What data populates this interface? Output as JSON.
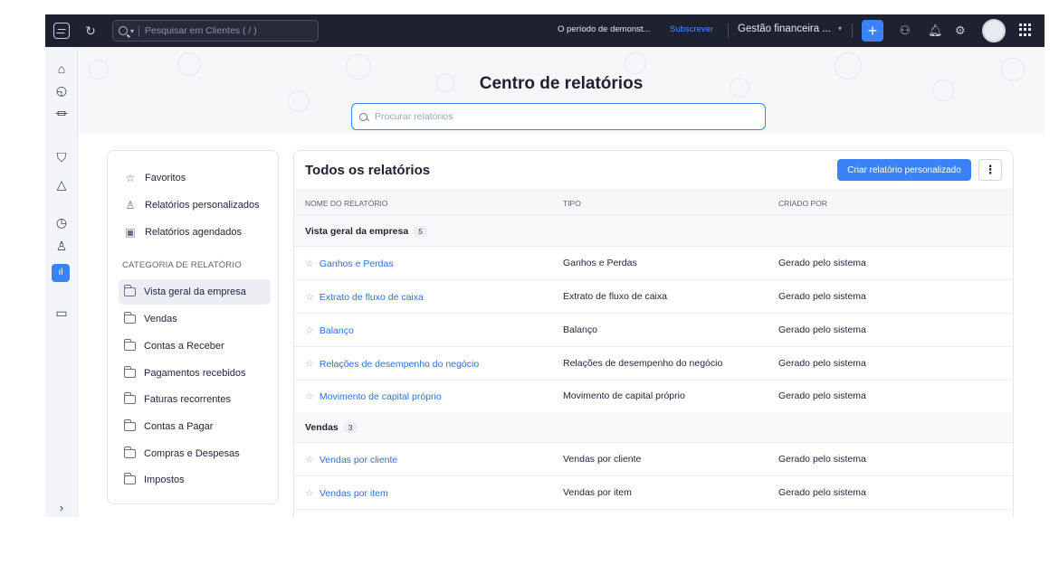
{
  "topbar": {
    "search_placeholder": "Pesquisar em Clientes ( / )",
    "trial_text": "O período de demonst...",
    "subscribe_label": "Subscrever",
    "org_name": "Gestão financeira ...",
    "plus_label": "+"
  },
  "hero": {
    "title": "Centro de relatórios",
    "search_placeholder": "Procurar relatórios"
  },
  "sidebar": {
    "favorites": "Favoritos",
    "custom_reports": "Relatórios personalizados",
    "scheduled_reports": "Relatórios agendados",
    "category_heading": "CATEGORIA DE RELATÓRIO",
    "categories": [
      "Vista geral da empresa",
      "Vendas",
      "Contas a Receber",
      "Pagamentos recebidos",
      "Faturas recorrentes",
      "Contas a Pagar",
      "Compras e Despesas",
      "Impostos"
    ]
  },
  "reports": {
    "title": "Todos os relatórios",
    "create_button": "Criar relatório personalizado",
    "more_button": "⋮",
    "columns": [
      "NOME DO RELATÓRIO",
      "TIPO",
      "CRIADO POR"
    ],
    "groups": [
      {
        "name": "Vista geral da empresa",
        "count": "5",
        "rows": [
          {
            "name": "Ganhos e Perdas",
            "type": "Ganhos e Perdas",
            "created_by": "Gerado pelo sistema"
          },
          {
            "name": "Extrato de fluxo de caixa",
            "type": "Extrato de fluxo de caixa",
            "created_by": "Gerado pelo sistema"
          },
          {
            "name": "Balanço",
            "type": "Balanço",
            "created_by": "Gerado pelo sistema"
          },
          {
            "name": "Relações de desempenho do negócio",
            "type": "Relações de desempenho do negócio",
            "created_by": "Gerado pelo sistema"
          },
          {
            "name": "Movimento de capital próprio",
            "type": "Movimento de capital próprio",
            "created_by": "Gerado pelo sistema"
          }
        ]
      },
      {
        "name": "Vendas",
        "count": "3",
        "rows": [
          {
            "name": "Vendas por cliente",
            "type": "Vendas por cliente",
            "created_by": "Gerado pelo sistema"
          },
          {
            "name": "Vendas por item",
            "type": "Vendas por item",
            "created_by": "Gerado pelo sistema"
          }
        ]
      }
    ]
  },
  "colors": {
    "topbar_bg": "#1e2230",
    "accent": "#3b82f6",
    "link": "#2f6fe4"
  },
  "icons": [
    "logo-icon",
    "refresh-icon",
    "search-icon",
    "people-icon",
    "bell-icon",
    "gear-icon",
    "avatar",
    "apps-grid-icon",
    "home-icon",
    "bag-icon",
    "bank-icon",
    "cart-icon",
    "shopping-bag-icon",
    "clock-icon",
    "user-icon",
    "reports-icon",
    "folder-icon",
    "chevron-right-icon",
    "star-icon"
  ]
}
